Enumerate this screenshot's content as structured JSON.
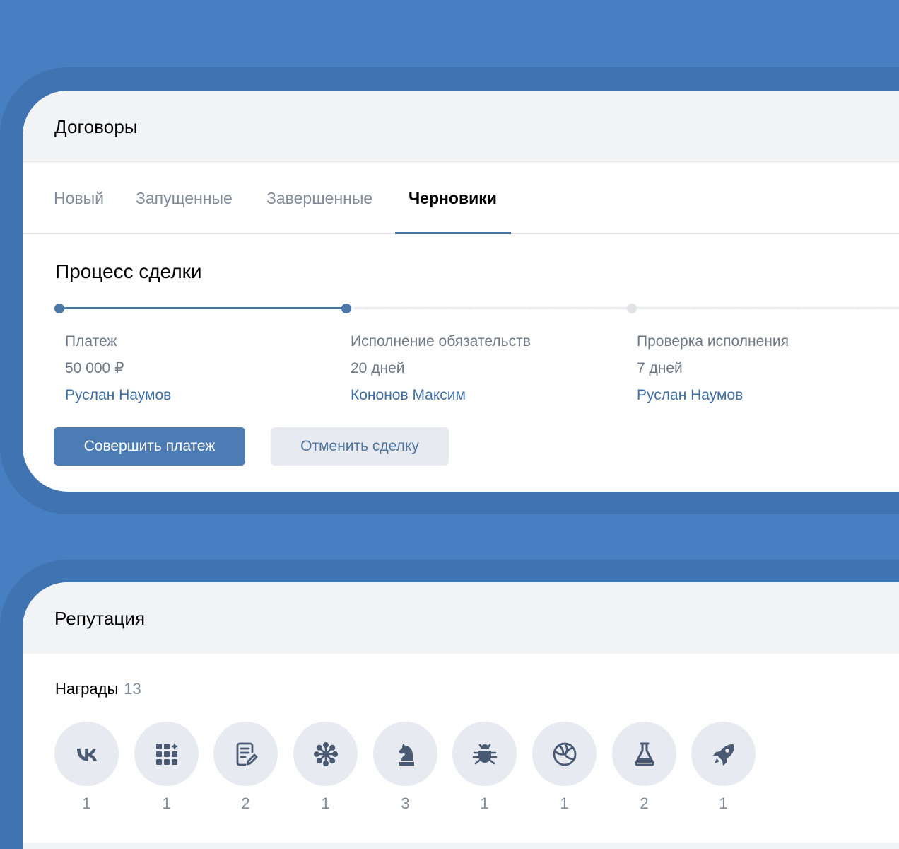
{
  "contracts": {
    "title": "Договоры",
    "tabs": [
      {
        "label": "Новый",
        "active": false
      },
      {
        "label": "Запущенные",
        "active": false
      },
      {
        "label": "Завершенные",
        "active": false
      },
      {
        "label": "Черновики",
        "active": true
      }
    ],
    "process_title": "Процесс сделки",
    "steps": [
      {
        "label": "Платеж",
        "value": "50 000 ₽",
        "person": "Руслан Наумов",
        "state": "done"
      },
      {
        "label": "Исполнение обязательств",
        "value": "20 дней",
        "person": "Кононов Максим",
        "state": "current"
      },
      {
        "label": "Проверка исполнения",
        "value": "7 дней",
        "person": "Руслан Наумов",
        "state": "pending"
      }
    ],
    "primary_button": "Совершить платеж",
    "secondary_button": "Отменить сделку"
  },
  "reputation": {
    "title": "Репутация",
    "awards_label": "Награды",
    "awards_count": "13",
    "awards": [
      {
        "icon": "vk-logo-icon",
        "count": "1"
      },
      {
        "icon": "apps-grid-icon",
        "count": "1"
      },
      {
        "icon": "document-edit-icon",
        "count": "2"
      },
      {
        "icon": "snowflake-icon",
        "count": "1"
      },
      {
        "icon": "chess-knight-icon",
        "count": "3"
      },
      {
        "icon": "bug-icon",
        "count": "1"
      },
      {
        "icon": "volleyball-icon",
        "count": "1"
      },
      {
        "icon": "flask-icon",
        "count": "2"
      },
      {
        "icon": "rocket-icon",
        "count": "1"
      }
    ]
  },
  "colors": {
    "background": "#4680c2",
    "accent": "#4a76a8",
    "icon": "#4a5a73",
    "badge": "#e7ebf1"
  }
}
